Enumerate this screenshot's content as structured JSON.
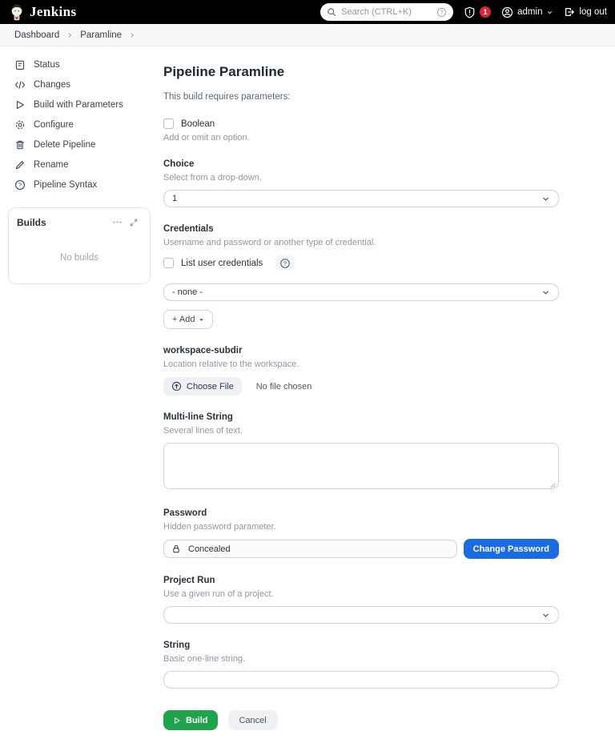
{
  "colors": {
    "header_bg": "#000000",
    "accent_blue": "#1b6ce2",
    "success_green": "#1fa34c",
    "badge_red": "#dc2632"
  },
  "icons": {
    "question_glyph": "?"
  },
  "header": {
    "brand": "Jenkins",
    "search_placeholder": "Search (CTRL+K)",
    "alert_count": "1",
    "user": "admin",
    "logout_label": "log out"
  },
  "breadcrumb": {
    "items": [
      {
        "label": "Dashboard"
      },
      {
        "label": "Paramline"
      }
    ]
  },
  "sidebar": {
    "items": [
      {
        "label": "Status"
      },
      {
        "label": "Changes"
      },
      {
        "label": "Build with Parameters"
      },
      {
        "label": "Configure"
      },
      {
        "label": "Delete Pipeline"
      },
      {
        "label": "Rename"
      },
      {
        "label": "Pipeline Syntax"
      }
    ],
    "builds_panel": {
      "title": "Builds",
      "empty_text": "No builds"
    }
  },
  "main": {
    "title": "Pipeline Paramline",
    "intro": "This build requires parameters:",
    "parameters": {
      "boolean": {
        "label": "Boolean",
        "description": "Add or omit an option.",
        "checked": false
      },
      "choice": {
        "label": "Choice",
        "description": "Select from a drop-down.",
        "value": "1"
      },
      "credentials": {
        "label": "Credentials",
        "description": "Username and password or another type of credential.",
        "checkbox_label": "List user credentials",
        "value": "- none -",
        "add_label": "+ Add"
      },
      "workspace_subdir": {
        "label": "workspace-subdir",
        "description": "Location relative to the workspace.",
        "button_label": "Choose File",
        "no_file_text": "No file chosen"
      },
      "multiline": {
        "label": "Multi-line String",
        "description": "Several lines of text.",
        "value": ""
      },
      "password": {
        "label": "Password",
        "description": "Hidden password parameter.",
        "value": "Concealed",
        "change_label": "Change Password"
      },
      "run": {
        "label": "Project Run",
        "description": "Use a given run of a project.",
        "value": ""
      },
      "string": {
        "label": "String",
        "description": "Basic one-line string.",
        "value": ""
      }
    },
    "actions": {
      "build_label": "Build",
      "cancel_label": "Cancel"
    }
  }
}
